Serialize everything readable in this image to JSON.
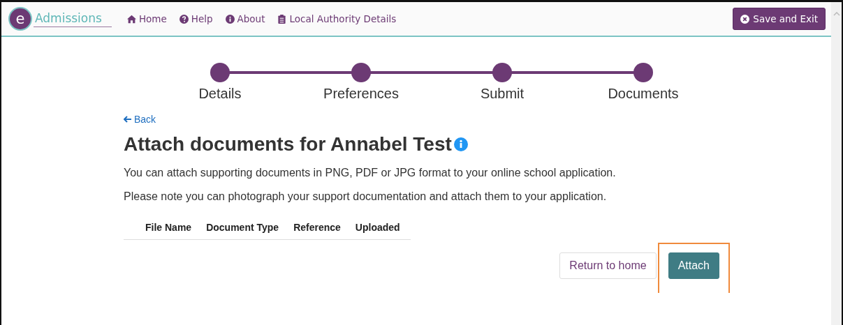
{
  "brand": {
    "logo_letter": "e",
    "name": "Admissions"
  },
  "nav": [
    {
      "label": "Home",
      "kind": "home"
    },
    {
      "label": "Help",
      "kind": "help"
    },
    {
      "label": "About",
      "kind": "info"
    },
    {
      "label": "Local Authority Details",
      "kind": "clipboard"
    }
  ],
  "save_button": "Save and Exit",
  "steps": [
    {
      "label": "Details"
    },
    {
      "label": "Preferences"
    },
    {
      "label": "Submit"
    },
    {
      "label": "Documents"
    }
  ],
  "back_link": "Back",
  "heading": "Attach documents for Annabel Test",
  "paragraphs": [
    "You can attach supporting documents in PNG, PDF or JPG format to your online school application.",
    "Please note you can photograph your support documentation and attach them to your application."
  ],
  "table": {
    "columns": [
      "File Name",
      "Document Type",
      "Reference",
      "Uploaded"
    ]
  },
  "buttons": [
    {
      "label": "Return to home",
      "kind": "secondary",
      "highlighted": false
    },
    {
      "label": "Attach",
      "kind": "primary",
      "highlighted": true
    }
  ]
}
